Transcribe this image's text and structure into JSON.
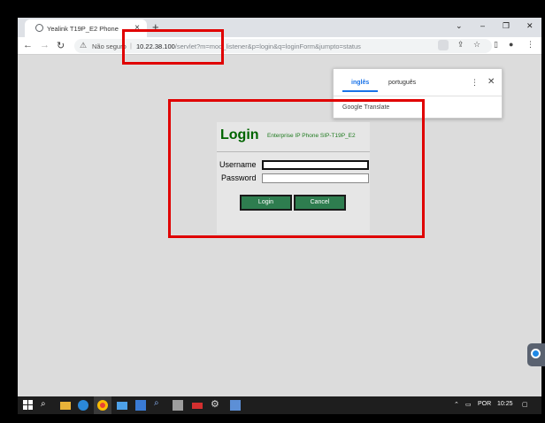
{
  "browser": {
    "tab_title": "Yealink T19P_E2 Phone",
    "tab_close": "×",
    "new_tab": "+",
    "window_controls": [
      "⌄",
      "–",
      "❐",
      "✕"
    ],
    "security_label": "Não seguro",
    "url_host": "10.22.38.100",
    "url_path": "/servlet?m=mod_listener&p=login&q=loginForm&jumpto=status"
  },
  "translate_popup": {
    "lang_source": "inglês",
    "lang_target": "português",
    "brand": "Google Translate",
    "more": "⋮",
    "close": "✕"
  },
  "login": {
    "title": "Login",
    "model": "Enterprise IP Phone SIP-T19P_E2",
    "username_label": "Username",
    "password_label": "Password",
    "username_value": "",
    "password_value": "",
    "login_button": "Login",
    "cancel_button": "Cancel"
  },
  "taskbar": {
    "language": "POR",
    "time": "10:25"
  },
  "colors": {
    "annotation": "#e00000",
    "brand_green": "#006400",
    "button_green": "#2e7d4f"
  }
}
